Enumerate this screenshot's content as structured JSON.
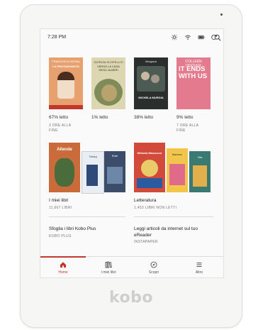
{
  "device": {
    "brand": "kobo"
  },
  "status": {
    "time": "7:28 PM"
  },
  "reading": [
    {
      "progress": "67% letto",
      "time_left": "3 ORE ALLA FINE",
      "cover": {
        "top": "FRANCESCA SERNA",
        "title": "LA PROTAGONISTA",
        "color": "#e7a16f"
      }
    },
    {
      "progress": "1% letto",
      "time_left": "",
      "cover": {
        "top": "GIORGIA SCOPELLITI",
        "title": "VERSO LA CASA DEGLI ALBERI",
        "color": "#dcd7b0"
      }
    },
    {
      "progress": "38% letto",
      "time_left": "",
      "cover": {
        "top": "Morgana",
        "title": "MICHELA MURGIA",
        "color": "#2a2e2c"
      }
    },
    {
      "progress": "9% letto",
      "time_left": "7 ORE ALLA FINE",
      "cover": {
        "top": "COLLEEN HOOVER",
        "title": "IT ENDS WITH US",
        "color": "#e37a8e"
      }
    }
  ],
  "collections": [
    {
      "title": "I miei libri",
      "subtitle": "11,667 LIBRI",
      "covers": [
        "Allende",
        "Tolstoj",
        "Roth"
      ]
    },
    {
      "title": "Letteratura",
      "subtitle": "1,453 LIBRI NON LETTI",
      "covers": [
        "Melania Mazzucco",
        "Mariano",
        "Vita"
      ]
    }
  ],
  "promos": [
    {
      "title": "Sfoglia i libri Kobo Plus",
      "subtitle": "KOBO PLUS"
    },
    {
      "title": "Leggi articoli da internet sul tuo eReader",
      "subtitle": "INSTAPAPER"
    }
  ],
  "tabs": [
    {
      "label": "Home",
      "icon": "home-icon",
      "active": true
    },
    {
      "label": "I miei libri",
      "icon": "books-icon",
      "active": false
    },
    {
      "label": "Scopri",
      "icon": "compass-icon",
      "active": false
    },
    {
      "label": "Altro",
      "icon": "menu-icon",
      "active": false
    }
  ],
  "colors": {
    "accent": "#c0392b"
  }
}
